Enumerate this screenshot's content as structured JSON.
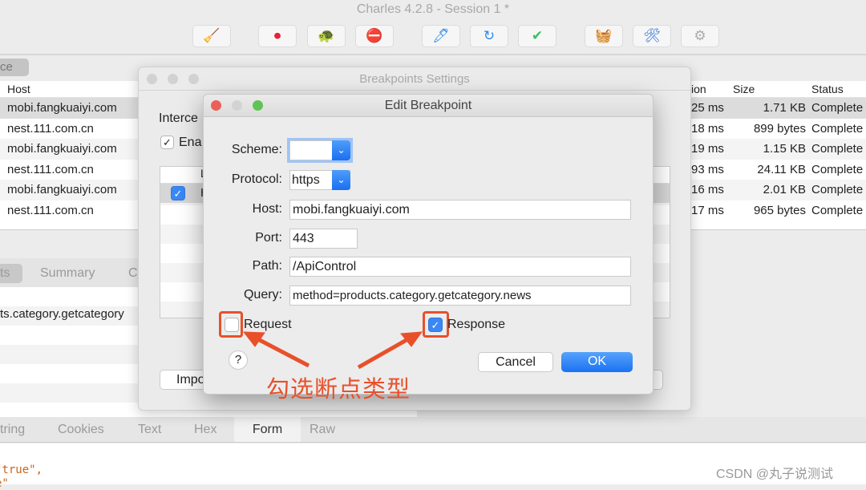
{
  "app": {
    "title": "Charles 4.2.8 - Session 1 *"
  },
  "toolbar": [
    {
      "icon": "broom-icon",
      "glyph": "🧹"
    },
    {
      "icon": "record-icon",
      "glyph": "⏺"
    },
    {
      "icon": "turtle-icon",
      "glyph": "🐢"
    },
    {
      "icon": "breakpoint-stop-icon",
      "glyph": "⛔"
    },
    {
      "icon": "pen-icon",
      "glyph": "🖊"
    },
    {
      "icon": "refresh-icon",
      "glyph": "↻"
    },
    {
      "icon": "check-icon",
      "glyph": "✔"
    },
    {
      "icon": "basket-icon",
      "glyph": "🧺"
    },
    {
      "icon": "tools-icon",
      "glyph": "🛠"
    },
    {
      "icon": "gear-icon",
      "glyph": "⚙"
    }
  ],
  "left_tab": "ce",
  "table": {
    "headers": {
      "host": "Host",
      "duration": "ion",
      "size": "Size",
      "status": "Status"
    },
    "rows": [
      {
        "host": "mobi.fangkuaiyi.com",
        "duration": "25 ms",
        "size": "1.71 KB",
        "status": "Complete"
      },
      {
        "host": "nest.111.com.cn",
        "duration": "18 ms",
        "size": "899 bytes",
        "status": "Complete"
      },
      {
        "host": "mobi.fangkuaiyi.com",
        "duration": "19 ms",
        "size": "1.15 KB",
        "status": "Complete"
      },
      {
        "host": "nest.111.com.cn",
        "duration": "93 ms",
        "size": "24.11 KB",
        "status": "Complete"
      },
      {
        "host": "mobi.fangkuaiyi.com",
        "duration": "16 ms",
        "size": "2.01 KB",
        "status": "Complete"
      },
      {
        "host": "nest.111.com.cn",
        "duration": "17 ms",
        "size": "965 bytes",
        "status": "Complete"
      }
    ]
  },
  "detail_tabs": [
    "ts",
    "Summary",
    "C"
  ],
  "detail_row": "ts.category.getcategory",
  "body_tabs": [
    "tring",
    "Cookies",
    "Text",
    "Hex",
    "Form",
    "Raw"
  ],
  "body_active": "Form",
  "code_lines": [
    "\"true\",",
    "e\""
  ],
  "bp_settings": {
    "title": "Breakpoints Settings",
    "intercept": "Interce",
    "enable": "Ena",
    "col": "L",
    "row_text": "H",
    "import": "Impo"
  },
  "edit": {
    "title": "Edit Breakpoint",
    "scheme_label": "Scheme:",
    "scheme_value": "",
    "protocol_label": "Protocol:",
    "protocol_value": "https",
    "host_label": "Host:",
    "host_value": "mobi.fangkuaiyi.com",
    "port_label": "Port:",
    "port_value": "443",
    "path_label": "Path:",
    "path_value": "/ApiControl",
    "query_label": "Query:",
    "query_value": "method=products.category.getcategory.news",
    "request_label": "Request",
    "request_checked": false,
    "response_label": "Response",
    "response_checked": true,
    "help": "?",
    "cancel": "Cancel",
    "ok": "OK"
  },
  "annotation": "勾选断点类型",
  "annotation_color": "#e8502a",
  "watermark": "CSDN @丸子说测试"
}
